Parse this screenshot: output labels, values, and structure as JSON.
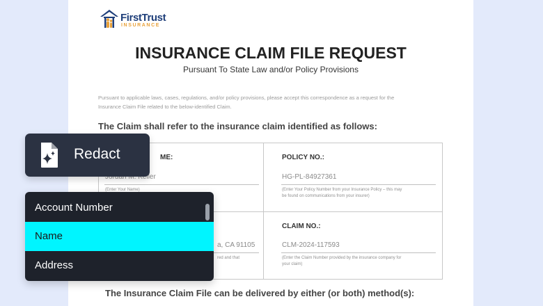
{
  "brand": {
    "name": "FirstTrust",
    "tagline": "INSURANCE",
    "logo_icon": "house-family-icon",
    "navy": "#1f3f7a",
    "orange": "#e8a13a"
  },
  "document": {
    "title": "INSURANCE CLAIM FILE REQUEST",
    "subtitle": "Pursuant To State Law and/or Policy Provisions",
    "intro_line1": "Pursuant to applicable laws, cases, regulations, and/or policy provisions, please accept this correspondence as a request for the",
    "intro_line2": "Insurance Claim File related to the below-identified Claim.",
    "claim_heading": "The Claim shall refer to the insurance claim identified as follows:",
    "delivery_heading": "The Insurance Claim File can be delivered by either (or both) method(s):"
  },
  "form": {
    "name_label": "ME:",
    "name_value": "Jordan M. Keller",
    "name_hint": "(Enter Your Name)",
    "policy_label": "POLICY NO.:",
    "policy_value": "HG-PL-84927361",
    "policy_hint_line1": "(Enter Your Policy Number from your Insurance Policy – this may",
    "policy_hint_line2": "be found on communications from your insurer)",
    "address_value": "a, CA 91105",
    "address_hint": "red and that",
    "claim_label": "CLAIM NO.:",
    "claim_value": "CLM-2024-117593",
    "claim_hint_line1": "(Enter the Claim Number provided by the insurance company for",
    "claim_hint_line2": "your claim)"
  },
  "redact": {
    "label": "Redact",
    "icon": "document-sparkle-icon"
  },
  "dropdown": {
    "items": [
      {
        "label": "Account Number",
        "selected": false
      },
      {
        "label": "Name",
        "selected": true
      },
      {
        "label": "Address",
        "selected": false
      }
    ],
    "highlight_color": "#00f5ff"
  }
}
